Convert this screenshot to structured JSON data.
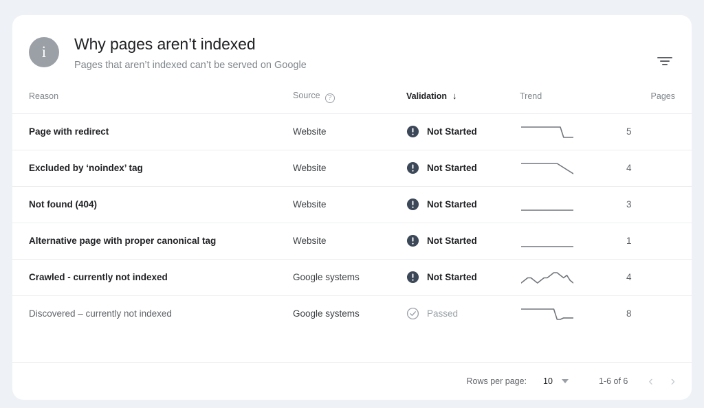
{
  "header": {
    "icon": "info-icon",
    "title": "Why pages aren’t indexed",
    "subtitle": "Pages that aren’t indexed can’t be served on Google",
    "filter_icon": "filter-icon"
  },
  "table": {
    "columns": {
      "reason": "Reason",
      "source": "Source",
      "source_help_icon": "?",
      "validation": "Validation",
      "sort_arrow": "↓",
      "trend": "Trend",
      "pages": "Pages"
    },
    "rows": [
      {
        "reason": "Page with redirect",
        "source": "Website",
        "validation": "Not Started",
        "status": "not-started",
        "pages": "5",
        "trend": [
          6,
          6,
          6,
          6,
          6,
          6,
          6,
          6,
          6,
          6,
          6,
          6,
          6,
          4,
          4,
          4,
          4
        ]
      },
      {
        "reason": "Excluded by ‘noindex’ tag",
        "source": "Website",
        "validation": "Not Started",
        "status": "not-started",
        "pages": "4",
        "trend": [
          7,
          7,
          7,
          7,
          7,
          7,
          7,
          7,
          7,
          7,
          7,
          7,
          6,
          5,
          4,
          3,
          2
        ]
      },
      {
        "reason": "Not found (404)",
        "source": "Website",
        "validation": "Not Started",
        "status": "not-started",
        "pages": "3",
        "trend": [
          5,
          5,
          5,
          5,
          5,
          5,
          5,
          5,
          5,
          5,
          5,
          5,
          5,
          5,
          5,
          5,
          5
        ]
      },
      {
        "reason": "Alternative page with proper canonical tag",
        "source": "Website",
        "validation": "Not Started",
        "status": "not-started",
        "pages": "1",
        "trend": [
          5,
          5,
          5,
          5,
          5,
          5,
          5,
          5,
          5,
          5,
          5,
          5,
          5,
          5,
          5,
          5,
          5
        ]
      },
      {
        "reason": "Crawled - currently not indexed",
        "source": "Google systems",
        "validation": "Not Started",
        "status": "not-started",
        "pages": "4",
        "trend": [
          3,
          4,
          5,
          5,
          4,
          3,
          4,
          5,
          5,
          6,
          7,
          7,
          6,
          5,
          6,
          4,
          3
        ]
      },
      {
        "reason": "Discovered – currently not indexed",
        "source": "Google systems",
        "validation": "Passed",
        "status": "passed",
        "pages": "8",
        "trend": [
          8,
          8,
          8,
          8,
          8,
          8,
          8,
          8,
          8,
          8,
          8,
          1,
          1,
          2,
          2,
          2,
          2
        ]
      }
    ]
  },
  "footer": {
    "rows_per_page_label": "Rows per page:",
    "rows_per_page_value": "10",
    "caret_icon": "chevron-down-icon",
    "range": "1-6 of 6",
    "prev_icon": "‹",
    "next_icon": "›"
  },
  "colors": {
    "page_background": "#eef1f6",
    "card_background": "#ffffff",
    "text_primary": "#202124",
    "text_secondary": "#5f6368",
    "text_muted": "#80868b",
    "status_not_started": "#3c4858",
    "status_passed": "#9aa0a6",
    "divider": "#edeef0",
    "sparkline": "#70757a"
  }
}
